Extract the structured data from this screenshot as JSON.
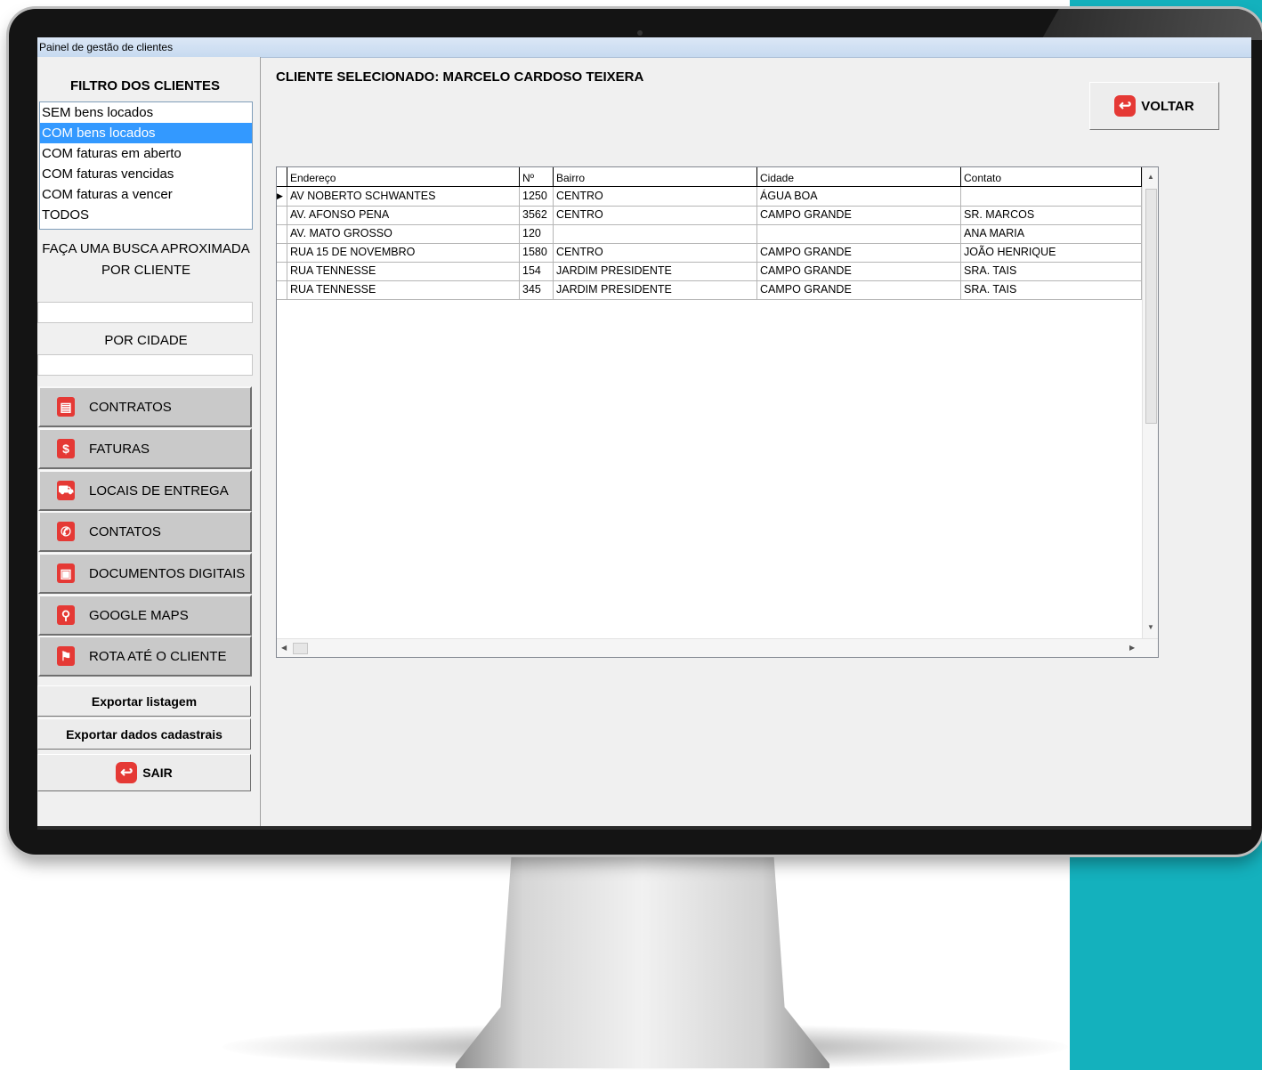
{
  "window": {
    "title": "Painel de gestão de clientes"
  },
  "filter": {
    "title": "FILTRO DOS CLIENTES",
    "items": [
      {
        "label": "SEM bens locados",
        "selected": false
      },
      {
        "label": "COM bens locados",
        "selected": true
      },
      {
        "label": "COM faturas em aberto",
        "selected": false
      },
      {
        "label": "COM faturas vencidas",
        "selected": false
      },
      {
        "label": "COM faturas a vencer",
        "selected": false
      },
      {
        "label": "TODOS",
        "selected": false
      }
    ]
  },
  "search": {
    "heading": "FAÇA UMA BUSCA APROXIMADA",
    "client_label": "POR CLIENTE",
    "client_value": "",
    "city_label": "POR CIDADE",
    "city_value": ""
  },
  "nav": [
    {
      "label": "CONTRATOS",
      "icon": "document-icon",
      "glyph": "▤"
    },
    {
      "label": "FATURAS",
      "icon": "dollar-icon",
      "glyph": "$"
    },
    {
      "label": "LOCAIS DE ENTREGA",
      "icon": "delivery-person-icon",
      "glyph": "⛟"
    },
    {
      "label": "CONTATOS",
      "icon": "phone-mail-icon",
      "glyph": "✆"
    },
    {
      "label": "DOCUMENTOS DIGITAIS",
      "icon": "digital-document-icon",
      "glyph": "▣"
    },
    {
      "label": "GOOGLE MAPS",
      "icon": "map-pin-icon",
      "glyph": "⚲"
    },
    {
      "label": "ROTA ATÉ O CLIENTE",
      "icon": "route-icon",
      "glyph": "⚑"
    }
  ],
  "actions": {
    "export_list": "Exportar listagem",
    "export_data": "Exportar dados cadastrais",
    "exit": "SAIR"
  },
  "main": {
    "client_title": "CLIENTE SELECIONADO: MARCELO CARDOSO TEIXERA",
    "back_label": "VOLTAR"
  },
  "table": {
    "columns": [
      "Endereço",
      "Nº",
      "Bairro",
      "Cidade",
      "Contato"
    ],
    "rows": [
      [
        "AV NOBERTO SCHWANTES",
        "1250",
        "CENTRO",
        "ÁGUA BOA",
        ""
      ],
      [
        "AV. AFONSO PENA",
        "3562",
        "CENTRO",
        "CAMPO GRANDE",
        "SR. MARCOS"
      ],
      [
        "AV. MATO GROSSO",
        "120",
        "",
        "",
        "ANA MARIA"
      ],
      [
        "RUA 15 DE NOVEMBRO",
        "1580",
        "CENTRO",
        "CAMPO GRANDE",
        "JOÃO HENRIQUE"
      ],
      [
        "RUA TENNESSE",
        "154",
        "JARDIM PRESIDENTE",
        "CAMPO GRANDE",
        "SRA. TAIS"
      ],
      [
        "RUA TENNESSE",
        "345",
        "JARDIM PRESIDENTE",
        "CAMPO GRANDE",
        "SRA. TAIS"
      ]
    ],
    "current_row_indicator": "▶"
  },
  "colors": {
    "accent": "#3399ff",
    "icon_red": "#e53935",
    "background_teal": "#14b1bd"
  }
}
